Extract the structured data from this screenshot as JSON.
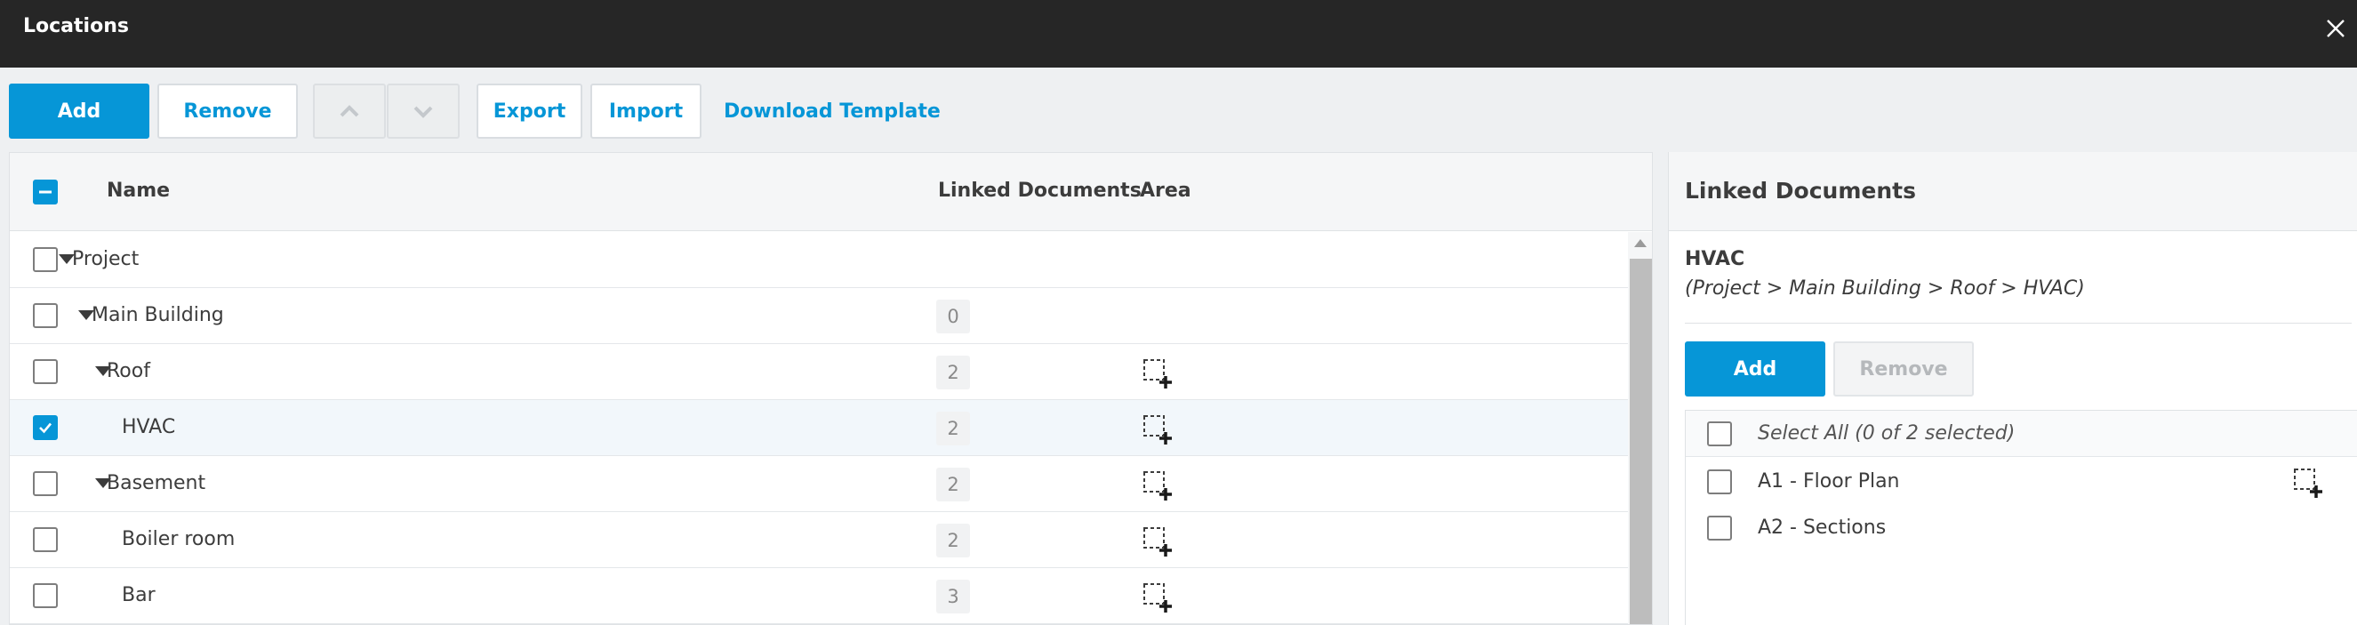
{
  "header": {
    "title": "Locations"
  },
  "toolbar": {
    "add_label": "Add",
    "remove_label": "Remove",
    "export_label": "Export",
    "import_label": "Import",
    "download_template_label": "Download Template"
  },
  "table": {
    "columns": {
      "name": "Name",
      "linked_documents": "Linked Documents",
      "area": "Area"
    },
    "rows": [
      {
        "name": "Project",
        "level": 0,
        "expandable": true,
        "count": "",
        "area": false,
        "checked": false
      },
      {
        "name": "Main Building",
        "level": 1,
        "expandable": true,
        "count": "0",
        "area": false,
        "checked": false
      },
      {
        "name": "Roof",
        "level": 2,
        "expandable": true,
        "count": "2",
        "area": true,
        "checked": false
      },
      {
        "name": "HVAC",
        "level": 3,
        "expandable": false,
        "count": "2",
        "area": true,
        "checked": true
      },
      {
        "name": "Basement",
        "level": 2,
        "expandable": true,
        "count": "2",
        "area": true,
        "checked": false
      },
      {
        "name": "Boiler room",
        "level": 3,
        "expandable": false,
        "count": "2",
        "area": true,
        "checked": false
      },
      {
        "name": "Bar",
        "level": 3,
        "expandable": false,
        "count": "3",
        "area": true,
        "checked": false
      }
    ]
  },
  "side_panel": {
    "title": "Linked Documents",
    "location_name": "HVAC",
    "location_path": "(Project > Main Building > Roof > HVAC)",
    "add_label": "Add",
    "remove_label": "Remove",
    "select_all_label": "Select All (0 of 2 selected)",
    "documents": [
      {
        "label": "A1 - Floor Plan",
        "area": true
      },
      {
        "label": "A2 - Sections",
        "area": false
      }
    ]
  },
  "colors": {
    "accent": "#0696d7",
    "header_bg": "#262626"
  },
  "icons": [
    "close-icon",
    "arrow-up-icon",
    "arrow-down-icon",
    "caret-down-icon",
    "check-icon",
    "indeterminate-icon",
    "area-select-icon"
  ]
}
